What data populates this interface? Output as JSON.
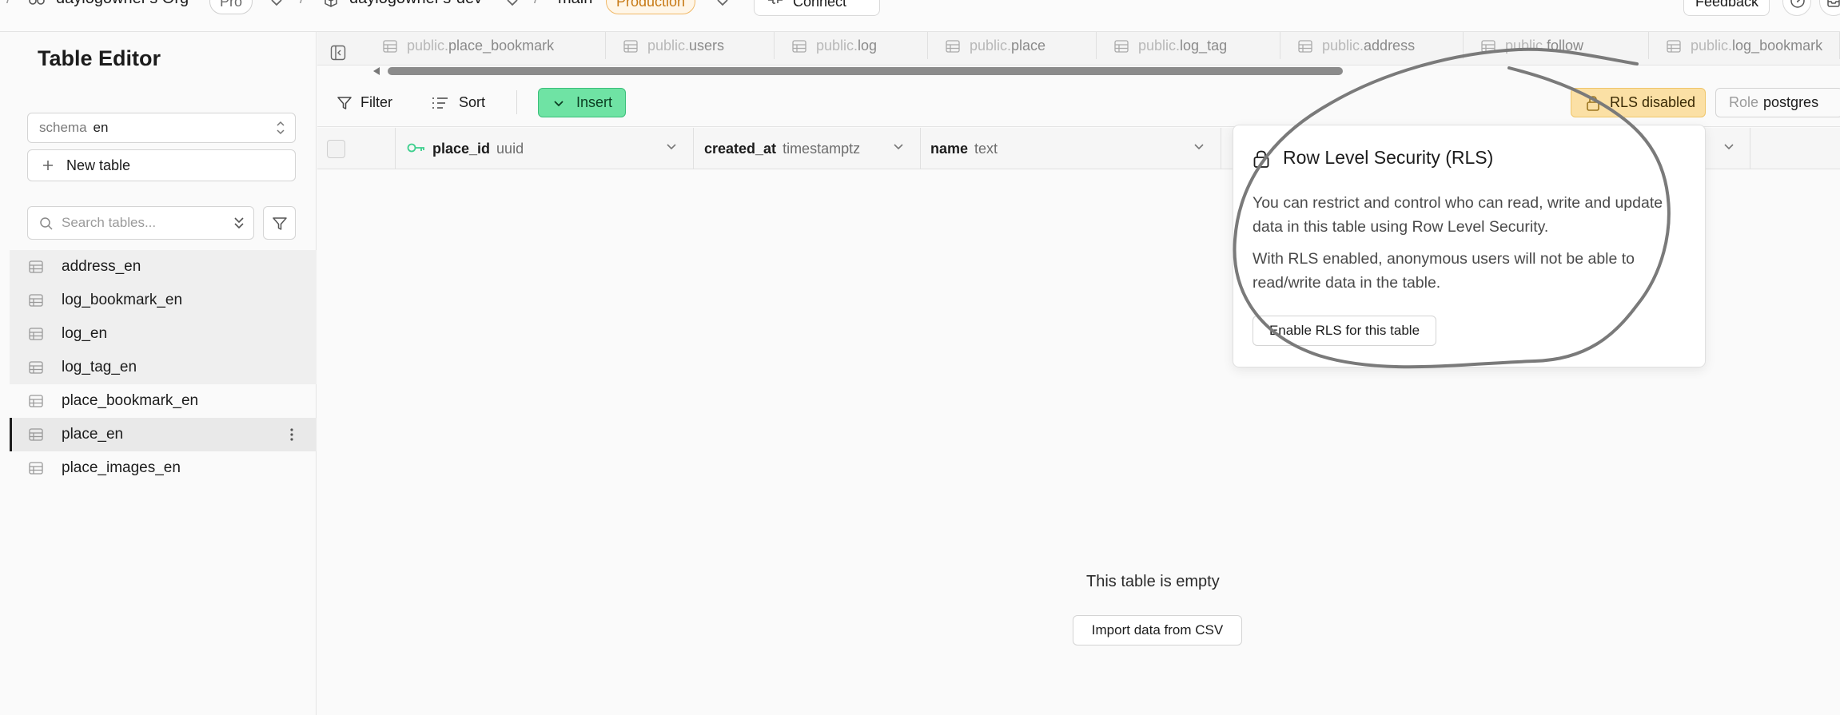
{
  "topbar": {
    "org_name": "daylogowner's Org",
    "plan_badge": "Pro",
    "project_name": "daylogowner's-dev",
    "branch_name": "main",
    "env_badge": "Production",
    "connect_label": "Connect",
    "feedback_label": "Feedback"
  },
  "sidebar": {
    "title": "Table Editor",
    "schema_label": "schema",
    "schema_value": "en",
    "new_table_label": "New table",
    "search_placeholder": "Search tables...",
    "tables": [
      {
        "label": "address_en"
      },
      {
        "label": "log_bookmark_en"
      },
      {
        "label": "log_en"
      },
      {
        "label": "log_tag_en"
      },
      {
        "label": "place_bookmark_en"
      },
      {
        "label": "place_en"
      },
      {
        "label": "place_images_en"
      }
    ]
  },
  "tabs": [
    {
      "schema": "public.",
      "name": "place_bookmark"
    },
    {
      "schema": "public.",
      "name": "users"
    },
    {
      "schema": "public.",
      "name": "log"
    },
    {
      "schema": "public.",
      "name": "place"
    },
    {
      "schema": "public.",
      "name": "log_tag"
    },
    {
      "schema": "public.",
      "name": "address"
    },
    {
      "schema": "public.",
      "name": "follow"
    },
    {
      "schema": "public.",
      "name": "log_bookmark"
    }
  ],
  "toolbar": {
    "filter_label": "Filter",
    "sort_label": "Sort",
    "insert_label": "Insert",
    "rls_label": "RLS disabled",
    "role_label": "Role",
    "role_value": "postgres"
  },
  "columns": [
    {
      "name": "place_id",
      "type": "uuid"
    },
    {
      "name": "created_at",
      "type": "timestamptz"
    },
    {
      "name": "name",
      "type": "text"
    }
  ],
  "empty_state": {
    "message": "This table is empty",
    "import_label": "Import data from CSV"
  },
  "rls_popover": {
    "title": "Row Level Security (RLS)",
    "paragraph1": "You can restrict and control who can read, write and update data in this table using Row Level Security.",
    "paragraph2": "With RLS enabled, anonymous users will not be able to read/write data in the table.",
    "button_label": "Enable RLS for this table"
  },
  "colors": {
    "insert_green": "#6fe3a4",
    "rls_warning": "#fbe0a5",
    "production_orange": "#c77a16",
    "annotation_stroke": "#7a7a7a"
  }
}
